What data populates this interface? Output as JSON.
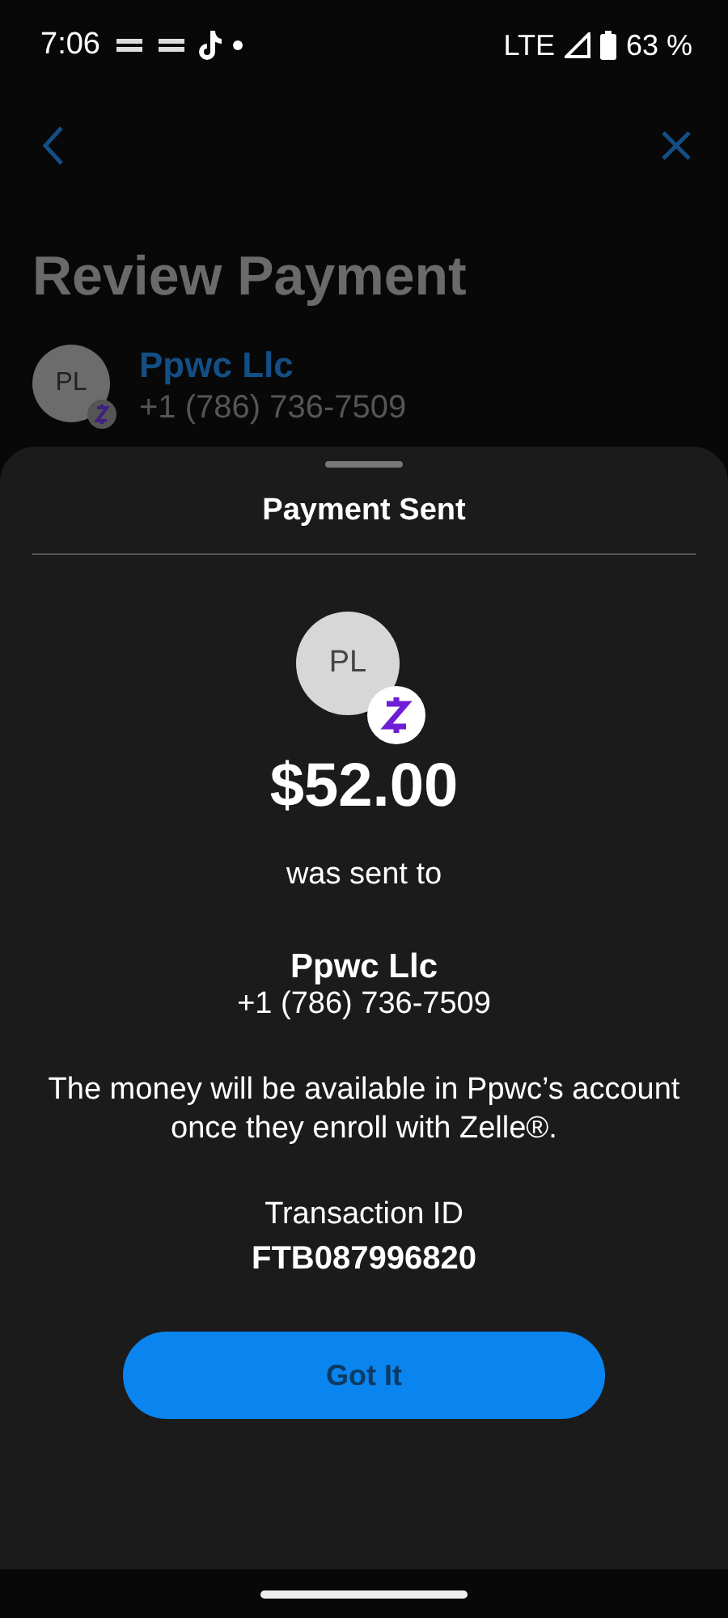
{
  "status_bar": {
    "time": "7:06",
    "network": "LTE",
    "battery": "63 %"
  },
  "background_page": {
    "title": "Review Payment",
    "contact": {
      "initials": "PL",
      "name": "Ppwc Llc",
      "phone": "+1 (786) 736-7509"
    }
  },
  "sheet": {
    "title": "Payment Sent",
    "initials": "PL",
    "amount": "$52.00",
    "sent_label": "was sent to",
    "name": "Ppwc Llc",
    "phone": "+1 (786) 736-7509",
    "message": "The money will be available in Ppwc’s account once they enroll with Zelle®.",
    "transaction_label": "Transaction ID",
    "transaction_id": "FTB087996820",
    "button": "Got It"
  }
}
